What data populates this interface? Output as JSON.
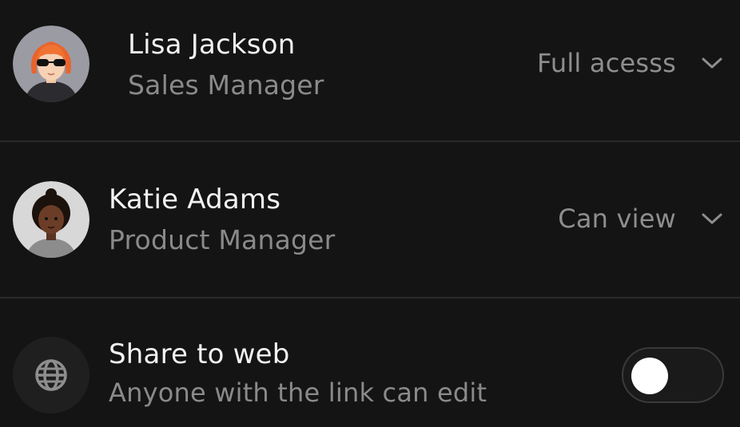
{
  "members": [
    {
      "name": "Lisa Jackson",
      "role": "Sales Manager",
      "permission": "Full acesss",
      "avatar_icon": "avatar-woman-sunglasses-icon"
    },
    {
      "name": "Katie Adams",
      "role": "Product Manager",
      "permission": "Can view",
      "avatar_icon": "avatar-woman-curly-hair-icon"
    }
  ],
  "share": {
    "title": "Share to web",
    "subtitle": "Anyone with the link can edit",
    "icon": "globe-icon",
    "enabled": false
  },
  "colors": {
    "background": "#141414",
    "divider": "#2a2a2a",
    "primary_text": "#f2f2f2",
    "secondary_text": "#8a8a8a"
  }
}
